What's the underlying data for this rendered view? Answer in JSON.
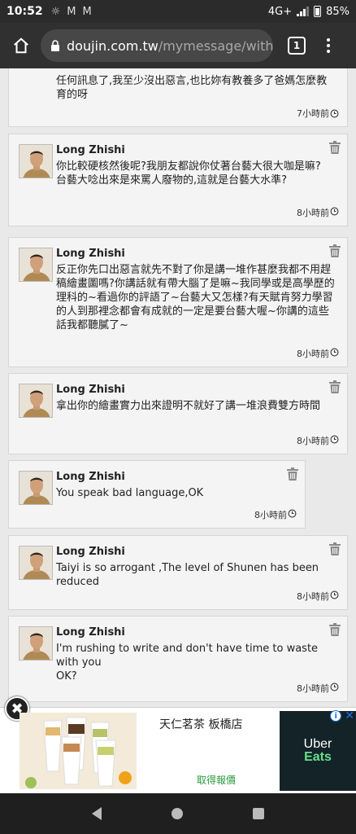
{
  "status_bar": {
    "time": "10:52",
    "network": "4G+",
    "battery": "85%",
    "notification_icons": [
      "weather-icon",
      "gmail-icon",
      "gmail-icon"
    ]
  },
  "browser": {
    "url_host": "doujin.com.tw",
    "url_path": "/mymessage/with",
    "tab_count": "1"
  },
  "messages": [
    {
      "author": "",
      "text": "任何訊息了,我至少沒出惡言,也比妳有教養多了爸媽怎麼教育的呀",
      "time": "7小時前"
    },
    {
      "author": "Long Zhishi",
      "text": "你比較硬核然後呢?我朋友都說你仗著台藝大很大咖是嘛?\n台藝大唸出來是來罵人廢物的,這就是台藝大水準?",
      "time": "8小時前"
    },
    {
      "author": "Long Zhishi",
      "text": "反正你先口出惡言就先不對了你是講一堆作甚麼我都不用趕稿繪畫圖嗎?你講話就有帶大腦了是嘛~我同學或是高學歷的理科的~看過你的評語了~台藝大又怎樣?有天賦肯努力學習的人到那裡念都會有成就的一定是要台藝大喔~你講的這些話我都聽膩了~",
      "time": "8小時前"
    },
    {
      "author": "Long Zhishi",
      "text": "拿出你的繪畫實力出來證明不就好了講一堆浪費雙方時間",
      "time": "8小時前"
    },
    {
      "author": "Long Zhishi",
      "text": "You speak bad language,OK",
      "time": "8小時前"
    },
    {
      "author": "Long Zhishi",
      "text": "Taiyi is so arrogant ,The level of Shunen has been reduced",
      "time": "8小時前"
    },
    {
      "author": "Long Zhishi",
      "text": "I'm rushing to write and don't have time to waste with you\nOK?",
      "time": "8小時前"
    }
  ],
  "ad": {
    "title": "天仁茗茶 板橋店",
    "link_text": "取得報價",
    "logo_line1": "Uber",
    "logo_line2": "Eats",
    "close_symbol": "✖"
  }
}
